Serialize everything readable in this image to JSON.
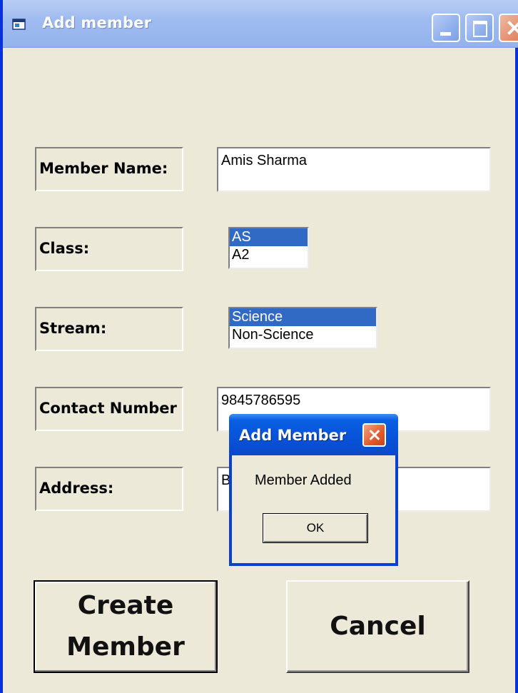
{
  "window": {
    "title": "Add member",
    "controls": {
      "minimize_icon": "minimize-icon",
      "maximize_icon": "maximize-icon",
      "close_icon": "close-icon"
    }
  },
  "form": {
    "member_name": {
      "label": "Member Name:",
      "value": "Amis Sharma"
    },
    "class": {
      "label": "Class:",
      "options": [
        "AS",
        "A2"
      ],
      "selected": "AS"
    },
    "stream": {
      "label": "Stream:",
      "options": [
        "Science",
        "Non-Science"
      ],
      "selected": "Science"
    },
    "contact_number": {
      "label": "Contact Number",
      "value": "9845786595"
    },
    "address": {
      "label": "Address:",
      "value": "B"
    }
  },
  "buttons": {
    "create_line1": "Create",
    "create_line2": "Member",
    "cancel": "Cancel"
  },
  "dialog": {
    "title": "Add Member",
    "message": "Member Added",
    "ok_label": "OK"
  },
  "colors": {
    "window_face": "#ece9d8",
    "selection": "#316ac5",
    "xp_blue": "#0752d8",
    "close_red": "#e05a2c"
  }
}
